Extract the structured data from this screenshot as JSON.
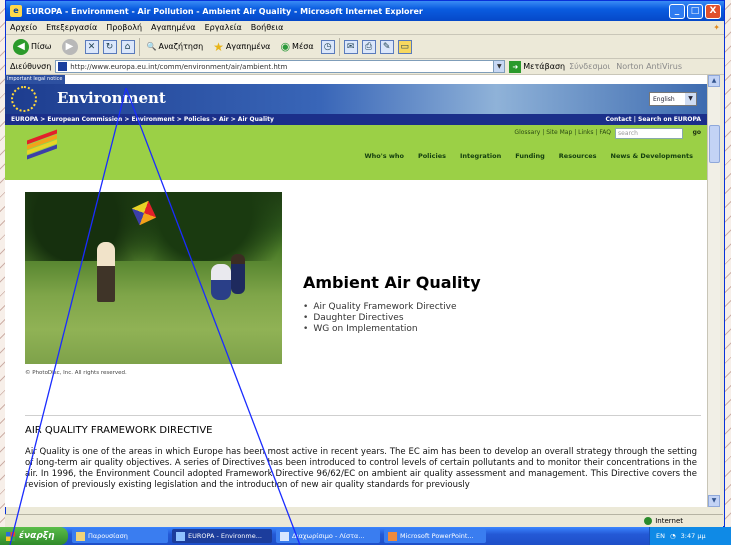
{
  "window": {
    "title": "EUROPA - Environment - Air Pollution - Ambient Air Quality - Microsoft Internet Explorer",
    "minimize": "_",
    "maximize": "□",
    "close": "X"
  },
  "menu": [
    "Αρχείο",
    "Επεξεργασία",
    "Προβολή",
    "Αγαπημένα",
    "Εργαλεία",
    "Βοήθεια"
  ],
  "toolbar": {
    "back": "Πίσω",
    "search": "Αναζήτηση",
    "favorites": "Αγαπημένα",
    "media": "Μέσα"
  },
  "address": {
    "label": "Διεύθυνση",
    "url": "http://www.europa.eu.int/comm/environment/air/ambient.htm",
    "go": "Μετάβαση",
    "links": [
      "Σύνδεσμοι",
      "Norton AntiVirus"
    ]
  },
  "site": {
    "important_notice": "Important legal notice",
    "banner_title": "Environment",
    "language": "English",
    "breadcrumb": "EUROPA > European Commission > Environment > Policies > Air > Air Quality",
    "contact": "Contact | Search on EUROPA",
    "utility_links": "Glossary | Site Map | Links | FAQ",
    "search_placeholder": "search",
    "search_go": "go",
    "nav": [
      "Who's who",
      "Policies",
      "Integration",
      "Funding",
      "Resources",
      "News & Developments"
    ],
    "photo_credit": "© PhotoDisc, Inc. All rights reserved.",
    "heading": "Ambient Air Quality",
    "links_list": [
      "Air Quality Framework Directive",
      "Daughter Directives",
      "WG on Implementation"
    ],
    "section_title": "AIR QUALITY FRAMEWORK DIRECTIVE",
    "section_text": "Air Quality is one of the areas in which Europe has been most active in recent years. The EC aim has been to develop an overall strategy through the setting of long-term air quality objectives. A series of Directives has been introduced to control levels of certain pollutants and to monitor their concentrations in the air. In 1996, the Environment Council adopted Framework Directive 96/62/EC on ambient air quality assessment and management. This Directive covers the revision of previously existing legislation and the introduction of new air quality standards for previously"
  },
  "status": {
    "zone": "Internet"
  },
  "taskbar": {
    "start": "έναρξη",
    "tasks": [
      "Παρουσίαση",
      "EUROPA - Environme...",
      "Διαχωρίσιμο - Λίστα...",
      "Microsoft PowerPoint..."
    ],
    "lang": "EN",
    "clock": "3:47 μμ"
  },
  "colors": {
    "site_green": "#9bd046",
    "site_blue": "#1b2f8a",
    "xp_blue": "#2459d6"
  }
}
